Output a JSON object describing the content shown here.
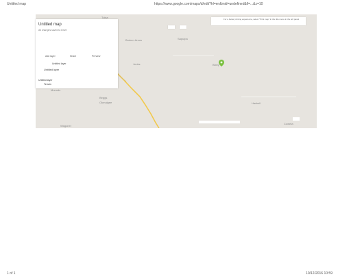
{
  "page": {
    "header_title": "Untitled map",
    "header_url": "https://www.google.com/maps/d/edit?hl=en&mid=undefined&ll=...&z=10",
    "footer_page": "1 of 1",
    "footer_datetime": "10/12/2016 10:59"
  },
  "map_panel": {
    "title": "Untitled map",
    "status": "All changes saved to Drive",
    "buttons": [
      "Add layer",
      "Share",
      "Preview"
    ],
    "layer_name": "Untitled layer",
    "untitled": "Untitled layer",
    "basemap_label": "Untitled layer",
    "basemap_value": "Terrain"
  },
  "notice": {
    "text": "For a better printing experience, select \"Print map\" in the title menu in the left panel"
  },
  "map": {
    "places": [
      "Tulsa",
      "Broken Arrow",
      "Sapulpa",
      "Jenks",
      "Bixby",
      "Sand Springs",
      "Mounds",
      "Beggs",
      "Okmulgee",
      "Haskell",
      "Coweta",
      "Wagoner"
    ],
    "pin_color": "#7cc142",
    "road_color": "#f2c94c",
    "land_color": "#e7e4df"
  },
  "icons": {
    "pin": "map-pin-icon"
  }
}
